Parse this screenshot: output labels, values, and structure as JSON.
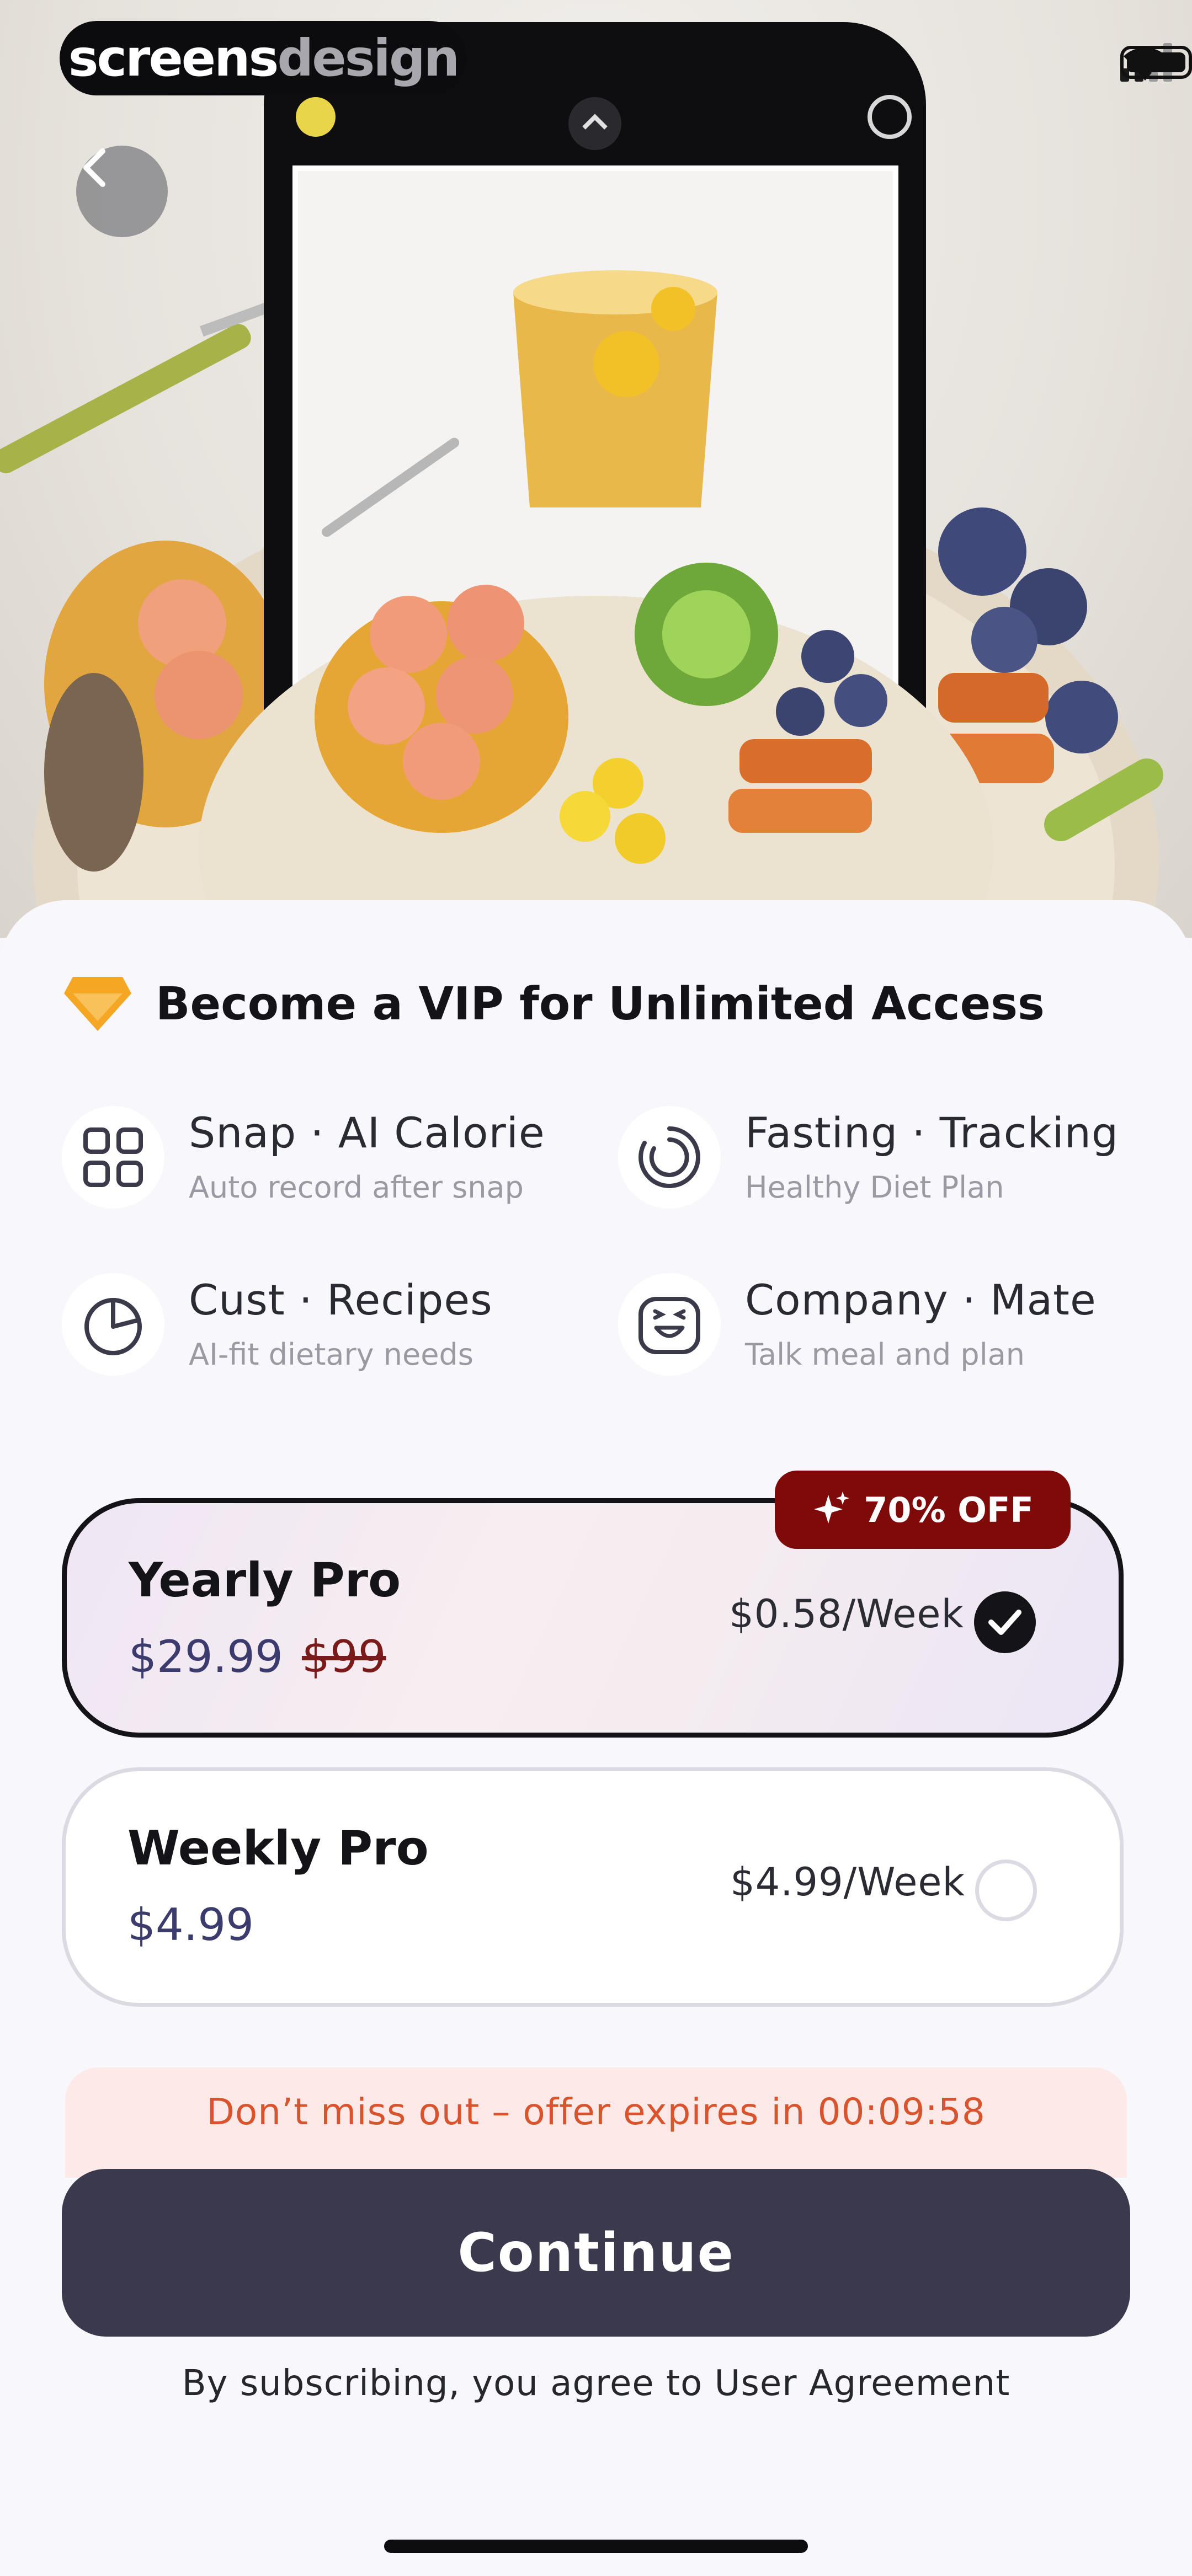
{
  "watermark": {
    "part1": "screens",
    "part2": "design"
  },
  "header": {
    "title": "Become a VIP for Unlimited Access"
  },
  "features": [
    {
      "title": "Snap · AI Calorie",
      "subtitle": "Auto record after snap",
      "icon": "scan-grid-icon"
    },
    {
      "title": "Fasting · Tracking",
      "subtitle": "Healthy Diet Plan",
      "icon": "progress-ring-icon"
    },
    {
      "title": "Cust · Recipes",
      "subtitle": "AI-fit dietary needs",
      "icon": "pie-chart-icon"
    },
    {
      "title": "Company · Mate",
      "subtitle": "Talk meal and plan",
      "icon": "smiley-face-icon"
    }
  ],
  "plans": {
    "badge": "70% OFF",
    "yearly": {
      "name": "Yearly Pro",
      "price": "$29.99",
      "old_price": "$99",
      "per_week": "$0.58/Week",
      "selected": true
    },
    "weekly": {
      "name": "Weekly Pro",
      "price": "$4.99",
      "per_week": "$4.99/Week",
      "selected": false
    }
  },
  "offer": {
    "text": "Don’t miss out – offer expires in 00:09:58"
  },
  "cta": {
    "label": "Continue"
  },
  "footer": {
    "agreement": "By subscribing, you agree to User Agreement"
  },
  "colors": {
    "accent_dark": "#3b394d",
    "badge": "#7e0a0a",
    "offer_text": "#d9542c",
    "diamond": "#f5a623"
  }
}
